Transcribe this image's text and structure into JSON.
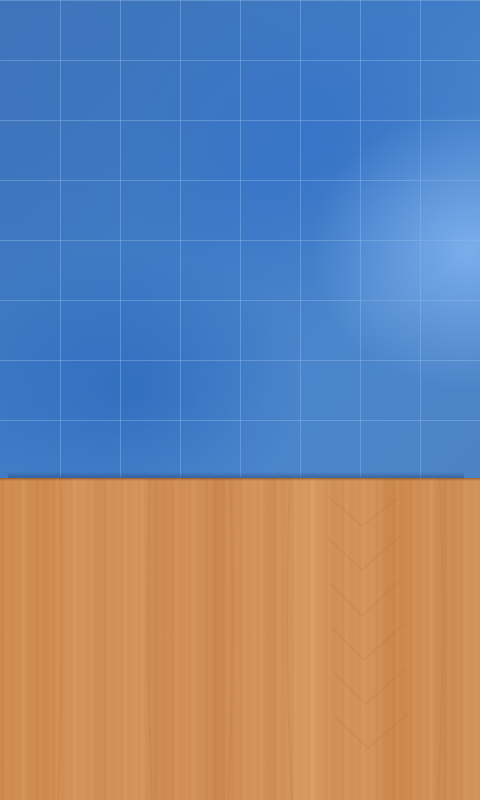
{
  "screen": {
    "board": {
      "grid_columns": 8,
      "grid_rows": 8,
      "colors": {
        "base": "#3f7bc6",
        "highlight": "#82b4f0",
        "grid_line": "#8fb7e6"
      }
    },
    "tray": {
      "material": "wood",
      "colors": {
        "base": "#d08b52",
        "grain": "#b8723a"
      }
    }
  }
}
